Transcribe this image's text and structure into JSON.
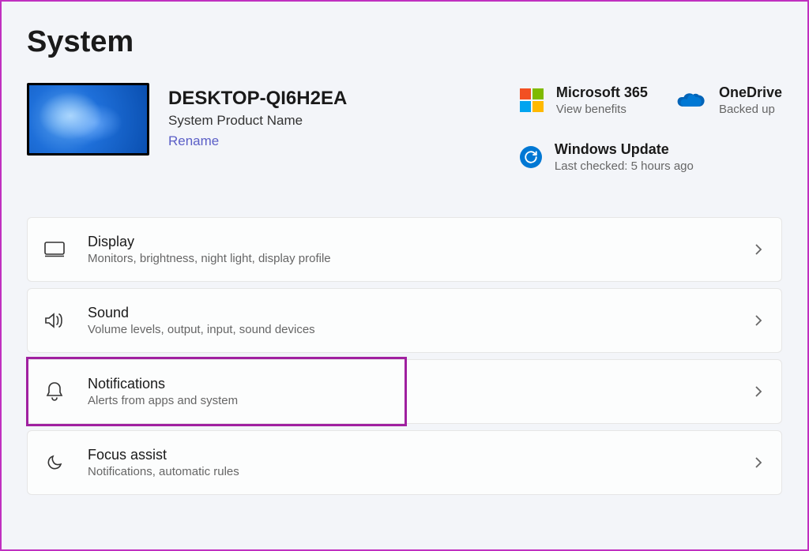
{
  "title": "System",
  "device": {
    "name": "DESKTOP-QI6H2EA",
    "product": "System Product Name",
    "rename_label": "Rename"
  },
  "status": {
    "ms365": {
      "title": "Microsoft 365",
      "sub": "View benefits"
    },
    "onedrive": {
      "title": "OneDrive",
      "sub": "Backed up"
    },
    "update": {
      "title": "Windows Update",
      "sub": "Last checked: 5 hours ago"
    }
  },
  "items": [
    {
      "icon": "display-icon",
      "title": "Display",
      "desc": "Monitors, brightness, night light, display profile",
      "highlighted": false
    },
    {
      "icon": "sound-icon",
      "title": "Sound",
      "desc": "Volume levels, output, input, sound devices",
      "highlighted": false
    },
    {
      "icon": "bell-icon",
      "title": "Notifications",
      "desc": "Alerts from apps and system",
      "highlighted": true
    },
    {
      "icon": "moon-icon",
      "title": "Focus assist",
      "desc": "Notifications, automatic rules",
      "highlighted": false
    }
  ]
}
